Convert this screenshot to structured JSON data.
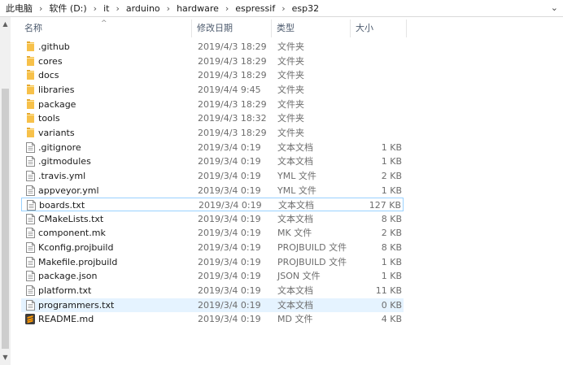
{
  "breadcrumb": [
    "此电脑",
    "软件 (D:)",
    "it",
    "arduino",
    "hardware",
    "espressif",
    "esp32"
  ],
  "columns": {
    "name": "名称",
    "date": "修改日期",
    "type": "类型",
    "size": "大小"
  },
  "files": [
    {
      "name": ".github",
      "date": "2019/4/3 18:29",
      "type": "文件夹",
      "size": "",
      "icon": "folder-icon"
    },
    {
      "name": "cores",
      "date": "2019/4/3 18:29",
      "type": "文件夹",
      "size": "",
      "icon": "folder-icon"
    },
    {
      "name": "docs",
      "date": "2019/4/3 18:29",
      "type": "文件夹",
      "size": "",
      "icon": "folder-icon"
    },
    {
      "name": "libraries",
      "date": "2019/4/4 9:45",
      "type": "文件夹",
      "size": "",
      "icon": "folder-icon"
    },
    {
      "name": "package",
      "date": "2019/4/3 18:29",
      "type": "文件夹",
      "size": "",
      "icon": "folder-icon"
    },
    {
      "name": "tools",
      "date": "2019/4/3 18:32",
      "type": "文件夹",
      "size": "",
      "icon": "folder-icon"
    },
    {
      "name": "variants",
      "date": "2019/4/3 18:29",
      "type": "文件夹",
      "size": "",
      "icon": "folder-icon"
    },
    {
      "name": ".gitignore",
      "date": "2019/3/4 0:19",
      "type": "文本文档",
      "size": "1 KB",
      "icon": "document-icon"
    },
    {
      "name": ".gitmodules",
      "date": "2019/3/4 0:19",
      "type": "文本文档",
      "size": "1 KB",
      "icon": "document-icon"
    },
    {
      "name": ".travis.yml",
      "date": "2019/3/4 0:19",
      "type": "YML 文件",
      "size": "2 KB",
      "icon": "document-icon"
    },
    {
      "name": "appveyor.yml",
      "date": "2019/3/4 0:19",
      "type": "YML 文件",
      "size": "1 KB",
      "icon": "document-icon"
    },
    {
      "name": "boards.txt",
      "date": "2019/3/4 0:19",
      "type": "文本文档",
      "size": "127 KB",
      "icon": "document-icon"
    },
    {
      "name": "CMakeLists.txt",
      "date": "2019/3/4 0:19",
      "type": "文本文档",
      "size": "8 KB",
      "icon": "document-icon"
    },
    {
      "name": "component.mk",
      "date": "2019/3/4 0:19",
      "type": "MK 文件",
      "size": "2 KB",
      "icon": "document-icon"
    },
    {
      "name": "Kconfig.projbuild",
      "date": "2019/3/4 0:19",
      "type": "PROJBUILD 文件",
      "size": "8 KB",
      "icon": "document-icon"
    },
    {
      "name": "Makefile.projbuild",
      "date": "2019/3/4 0:19",
      "type": "PROJBUILD 文件",
      "size": "1 KB",
      "icon": "document-icon"
    },
    {
      "name": "package.json",
      "date": "2019/3/4 0:19",
      "type": "JSON 文件",
      "size": "1 KB",
      "icon": "document-icon"
    },
    {
      "name": "platform.txt",
      "date": "2019/3/4 0:19",
      "type": "文本文档",
      "size": "11 KB",
      "icon": "document-icon"
    },
    {
      "name": "programmers.txt",
      "date": "2019/3/4 0:19",
      "type": "文本文档",
      "size": "0 KB",
      "icon": "document-icon"
    },
    {
      "name": "README.md",
      "date": "2019/3/4 0:19",
      "type": "MD 文件",
      "size": "4 KB",
      "icon": "sublime-file-icon"
    }
  ],
  "selected_row": "boards.txt",
  "hover_row": "programmers.txt",
  "colors": {
    "folder": "#f7c14a",
    "selection_border": "#99d1ff",
    "hover_bg": "#e5f3ff",
    "header_text": "#4d5b6e"
  }
}
